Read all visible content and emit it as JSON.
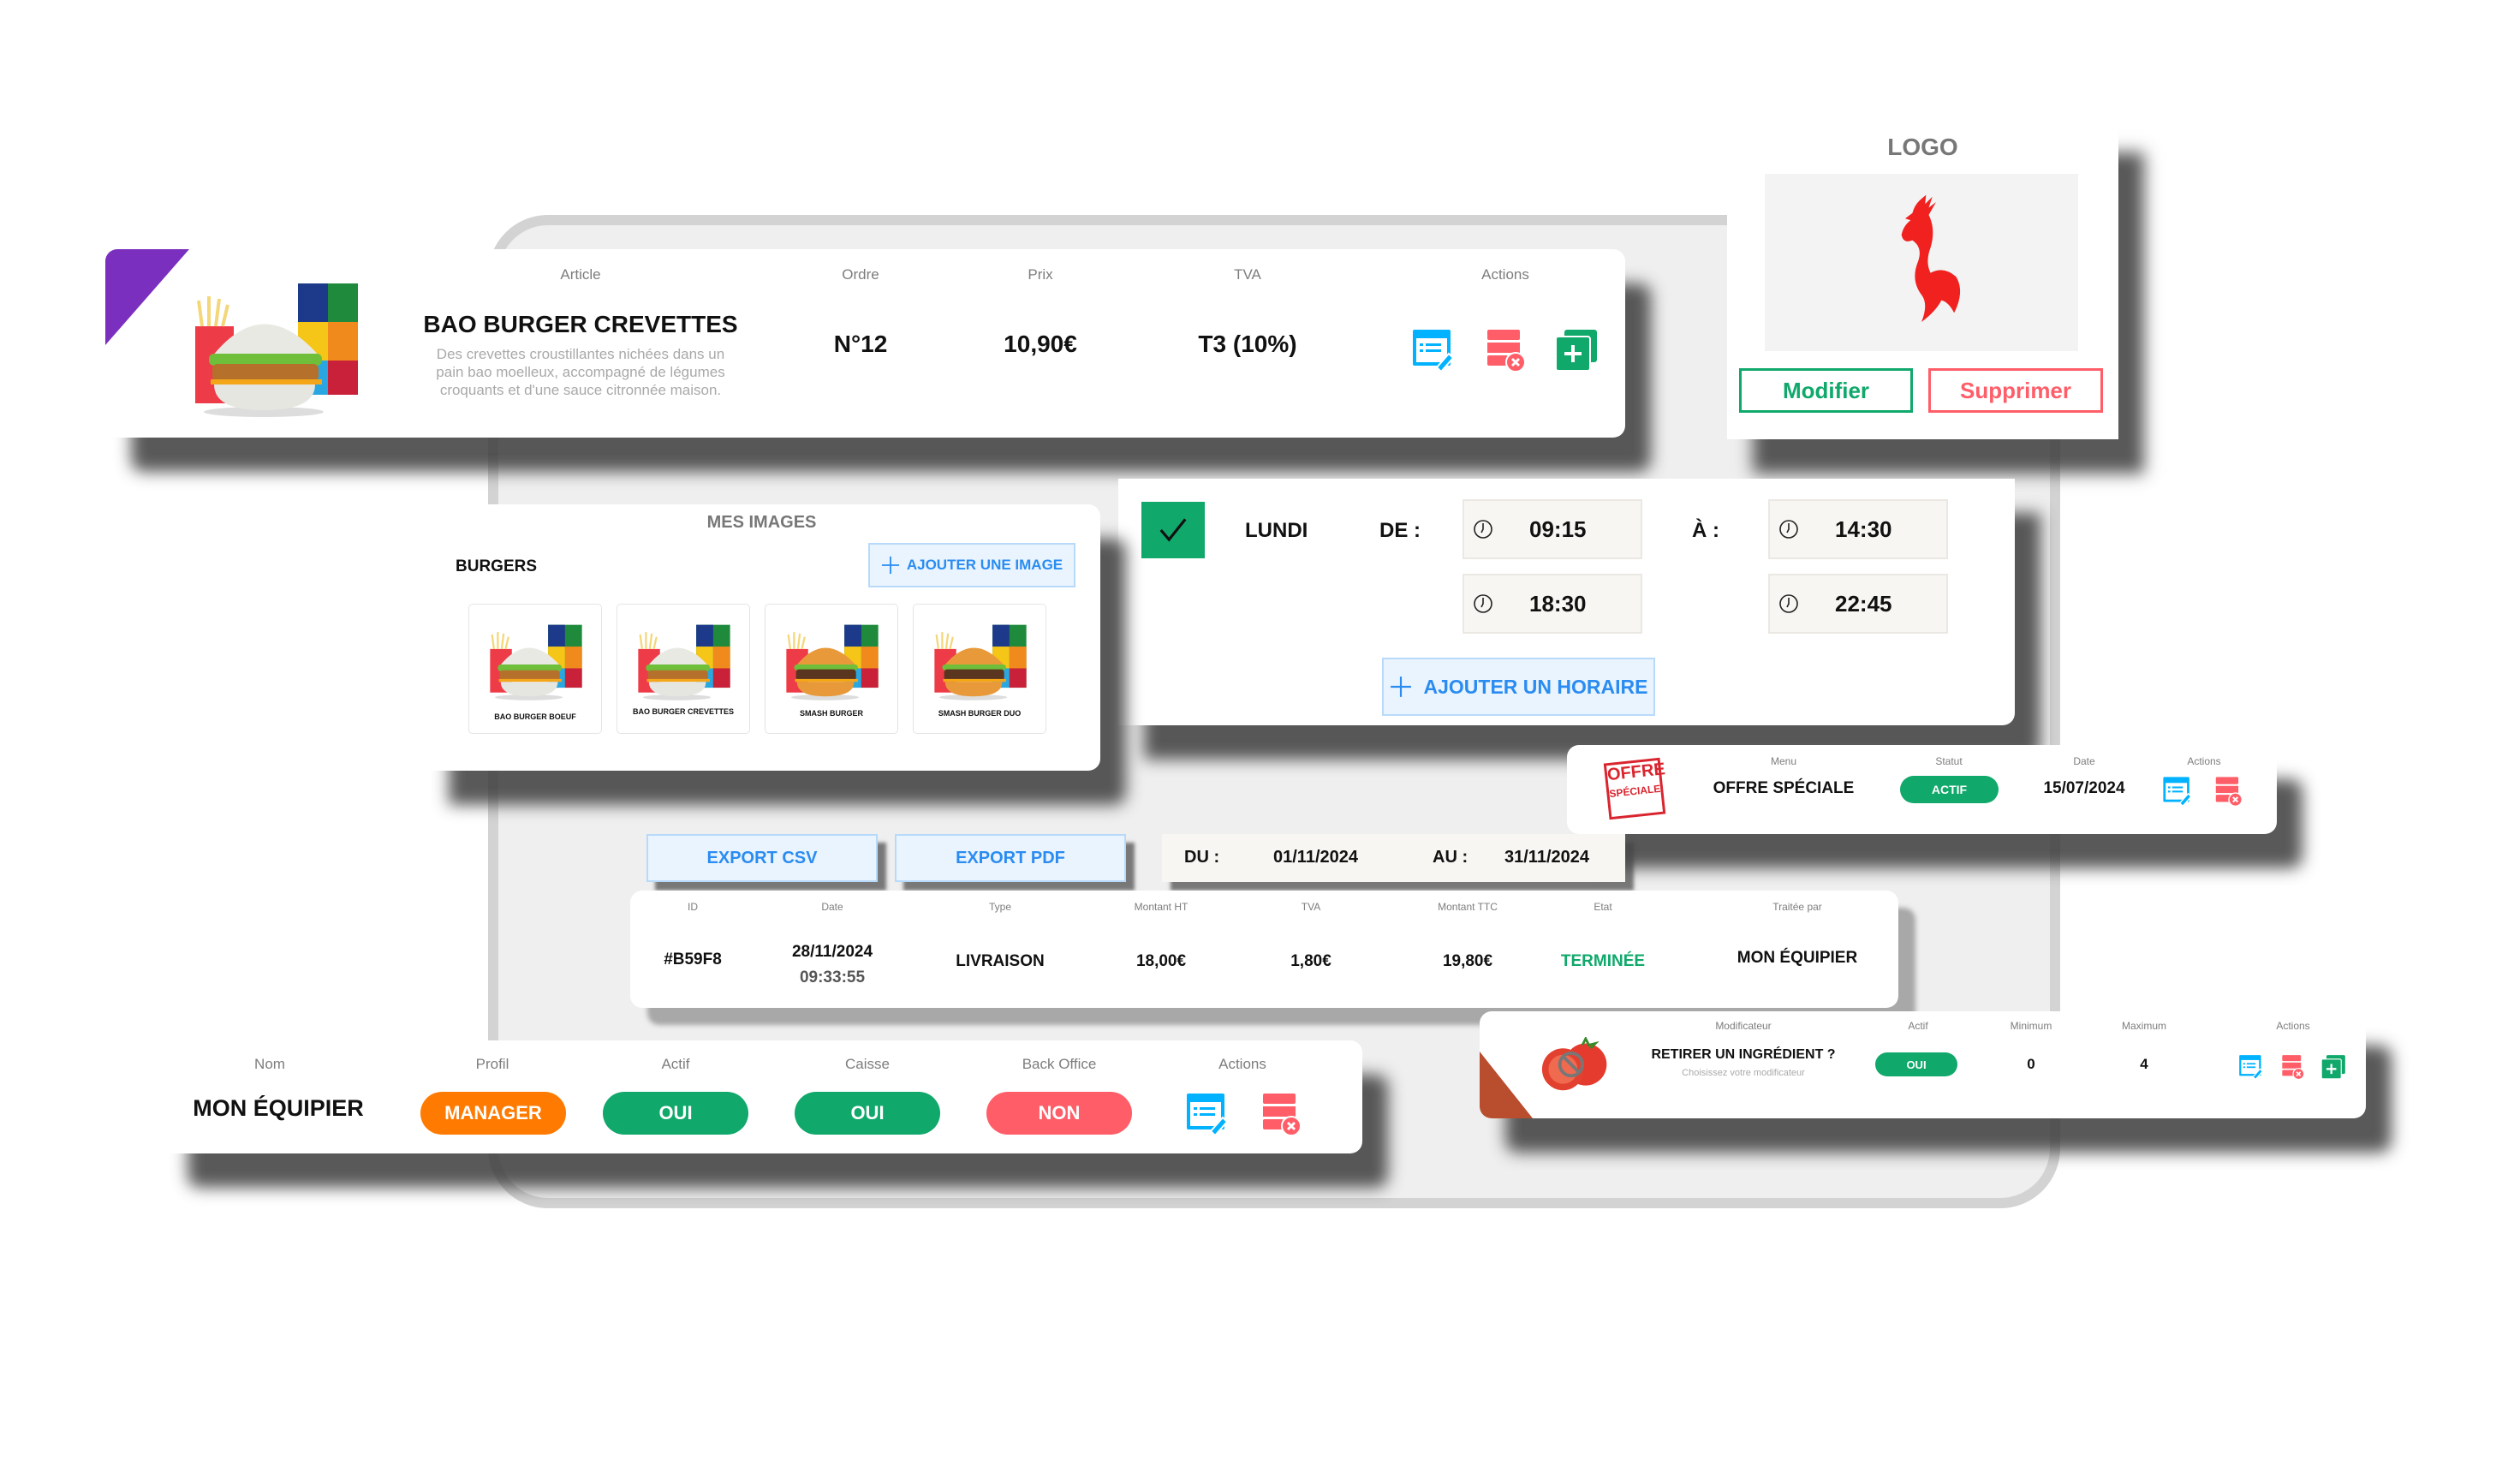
{
  "article_card": {
    "headers": {
      "article": "Article",
      "ordre": "Ordre",
      "prix": "Prix",
      "tva": "TVA",
      "actions": "Actions"
    },
    "name": "BAO BURGER CREVETTES",
    "description_lines": [
      "Des crevettes croustillantes nichées dans un",
      "pain bao moelleux, accompagné de légumes",
      "croquants et d'une sauce citronnée maison."
    ],
    "ordre": "N°12",
    "prix": "10,90€",
    "tva": "T3 (10%)",
    "accent_color": "#7b2fbe",
    "actions": [
      "edit-icon",
      "delete-icon",
      "duplicate-icon"
    ]
  },
  "logo_card": {
    "title": "LOGO",
    "modify_label": "Modifier",
    "delete_label": "Supprimer",
    "logo_icon": "rooster-logo"
  },
  "images_card": {
    "title": "MES IMAGES",
    "category": "BURGERS",
    "add_label": "AJOUTER UNE IMAGE",
    "images": [
      {
        "label": "BAO BURGER BOEUF"
      },
      {
        "label": "BAO BURGER CREVETTES"
      },
      {
        "label": "SMASH BURGER"
      },
      {
        "label": "SMASH BURGER DUO"
      }
    ]
  },
  "schedule_card": {
    "day": "LUNDI",
    "checked": true,
    "from_label": "DE :",
    "to_label": "À :",
    "slots": [
      {
        "from": "09:15",
        "to": "14:30"
      },
      {
        "from": "18:30",
        "to": "22:45"
      }
    ],
    "add_label": "AJOUTER UN HORAIRE"
  },
  "offer_card": {
    "headers": {
      "menu": "Menu",
      "statut": "Statut",
      "date": "Date",
      "actions": "Actions"
    },
    "badge_top": "OFFRE",
    "badge_bottom": "SPÉCIALE",
    "menu": "OFFRE SPÉCIALE",
    "statut": "ACTIF",
    "date": "15/07/2024",
    "actions": [
      "edit-icon",
      "delete-icon"
    ]
  },
  "export_bar": {
    "csv_label": "EXPORT CSV",
    "pdf_label": "EXPORT PDF",
    "from_label": "DU :",
    "from_date": "01/11/2024",
    "to_label": "AU :",
    "to_date": "31/11/2024"
  },
  "transactions": {
    "headers": [
      "ID",
      "Date",
      "Type",
      "Montant HT",
      "TVA",
      "Montant TTC",
      "Etat",
      "Traitée par"
    ],
    "row": {
      "id": "#B59F8",
      "date": "28/11/2024",
      "time": "09:33:55",
      "type": "LIVRAISON",
      "montant_ht": "18,00€",
      "tva": "1,80€",
      "montant_ttc": "19,80€",
      "etat": "TERMINÉE",
      "traitee_par": "MON ÉQUIPIER"
    }
  },
  "modifier_card": {
    "headers": {
      "modificateur": "Modificateur",
      "actif": "Actif",
      "minimum": "Minimum",
      "maximum": "Maximum",
      "actions": "Actions"
    },
    "title": "RETIRER UN INGRÉDIENT ?",
    "subtitle": "Choisissez votre modificateur",
    "actif": "OUI",
    "minimum": "0",
    "maximum": "4",
    "accent_color": "#b84e2e",
    "actions": [
      "edit-icon",
      "delete-icon",
      "duplicate-icon"
    ]
  },
  "staff_card": {
    "headers": {
      "nom": "Nom",
      "profil": "Profil",
      "actif": "Actif",
      "caisse": "Caisse",
      "back_office": "Back Office",
      "actions": "Actions"
    },
    "nom": "MON ÉQUIPIER",
    "profil": "MANAGER",
    "actif": "OUI",
    "caisse": "OUI",
    "back_office": "NON",
    "actions": [
      "edit-icon",
      "delete-icon"
    ]
  },
  "colors": {
    "green": "#10a86b",
    "orange": "#ff7a00",
    "red": "#ff5e69",
    "blue": "#2a8cf1",
    "edit_blue": "#00b2ff"
  }
}
